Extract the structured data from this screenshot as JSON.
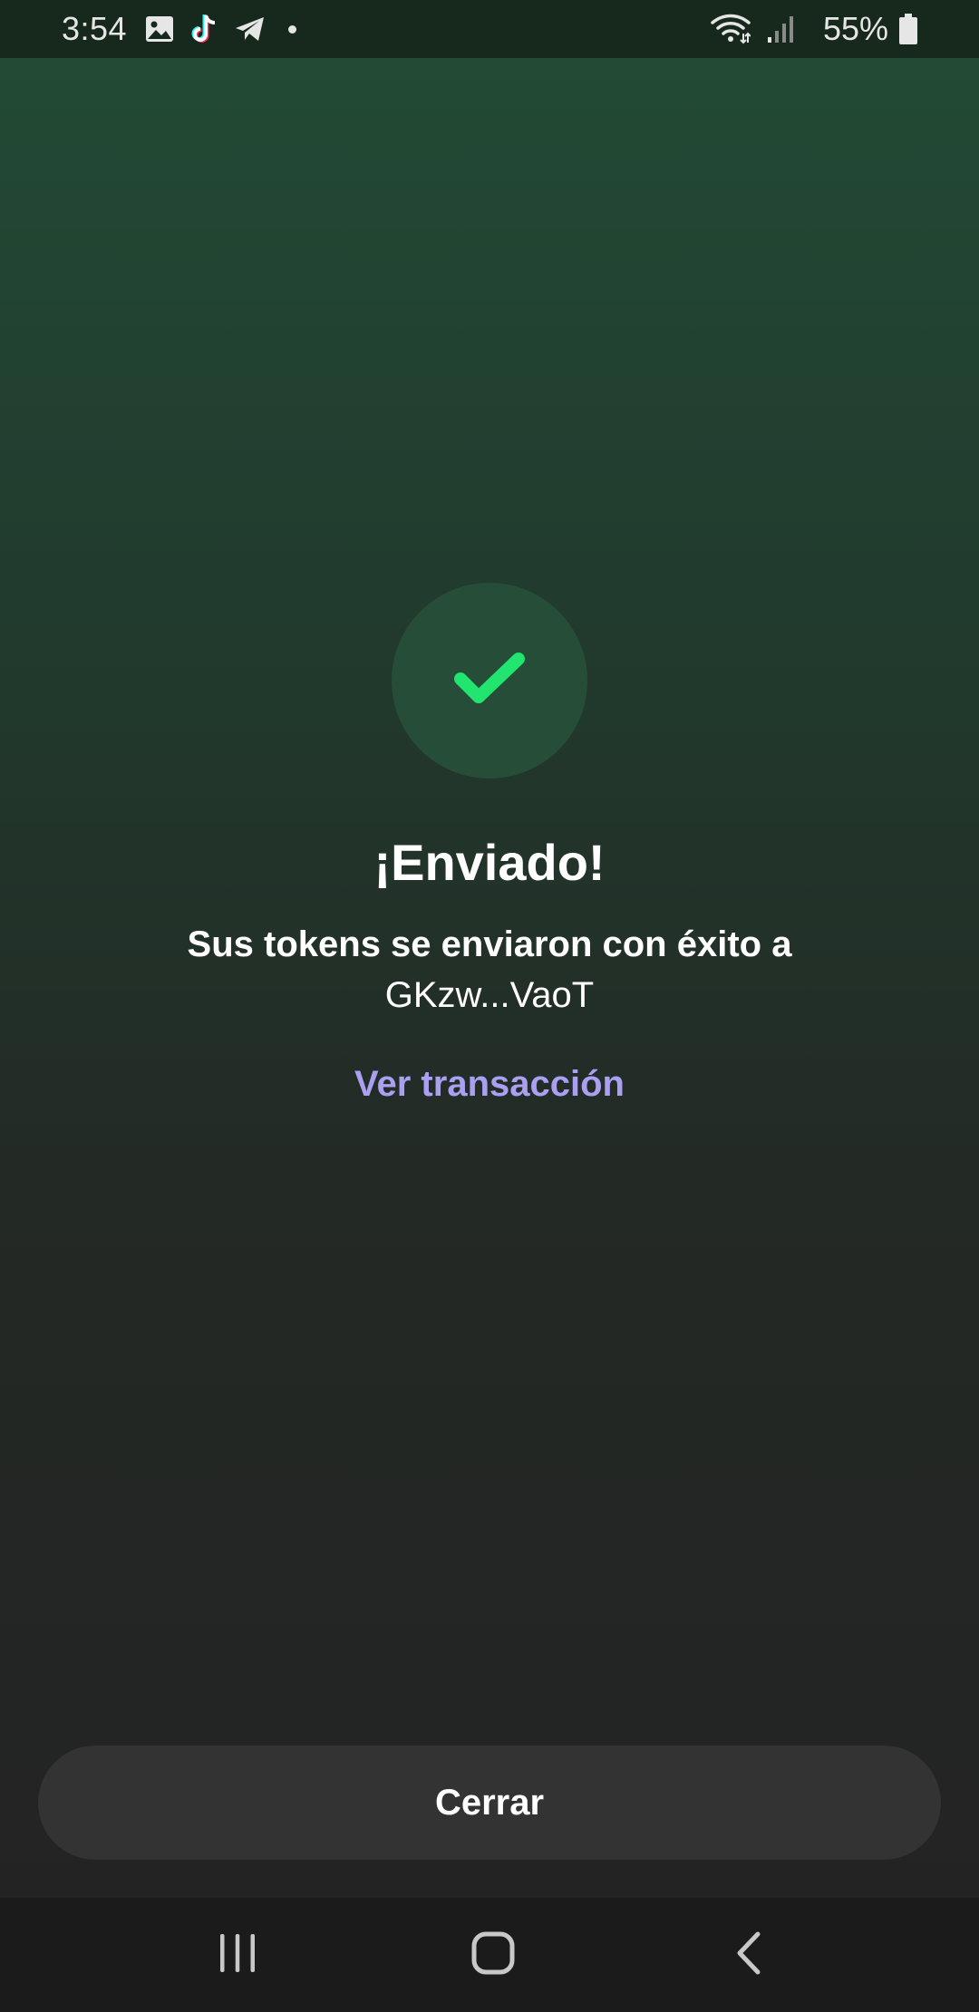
{
  "status_bar": {
    "time": "3:54",
    "battery_percent": "55%",
    "notification_icons": [
      "gallery-icon",
      "tiktok-icon",
      "telegram-icon",
      "dot-icon"
    ],
    "system_icons": [
      "wifi-icon",
      "signal-icon",
      "battery-icon"
    ]
  },
  "success": {
    "icon": "checkmark-icon",
    "title": "¡Enviado!",
    "message": "Sus tokens se enviaron con éxito a",
    "recipient": "GKzw...VaoT",
    "link_label": "Ver transacción"
  },
  "actions": {
    "close_label": "Cerrar"
  },
  "navigation": {
    "buttons": [
      "recent-apps-icon",
      "home-icon",
      "back-icon"
    ]
  },
  "colors": {
    "accent_green": "#21e56f",
    "link_purple": "#ab9ff2",
    "button_bg": "#333333"
  }
}
